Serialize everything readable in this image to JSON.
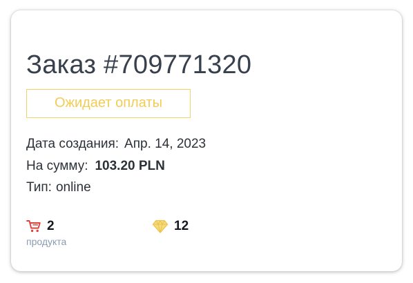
{
  "order": {
    "title": "Заказ #709771320",
    "status": "Ожидает оплаты",
    "created_label": "Дата создания:",
    "created_value": "Апр. 14, 2023",
    "amount_label": "На сумму:",
    "amount_value": "103.20 PLN",
    "type_label": "Тип:",
    "type_value": "online"
  },
  "stats": {
    "products_count": "2",
    "products_label": "продукта",
    "products_icon": "cart-icon",
    "gems_count": "12",
    "gems_icon": "diamond-icon"
  },
  "colors": {
    "status": "#f2cc55",
    "cart_icon": "#e0403a",
    "diamond_icon": "#f2d56a",
    "sublabel": "#8a9bb2",
    "title": "#37404c"
  }
}
